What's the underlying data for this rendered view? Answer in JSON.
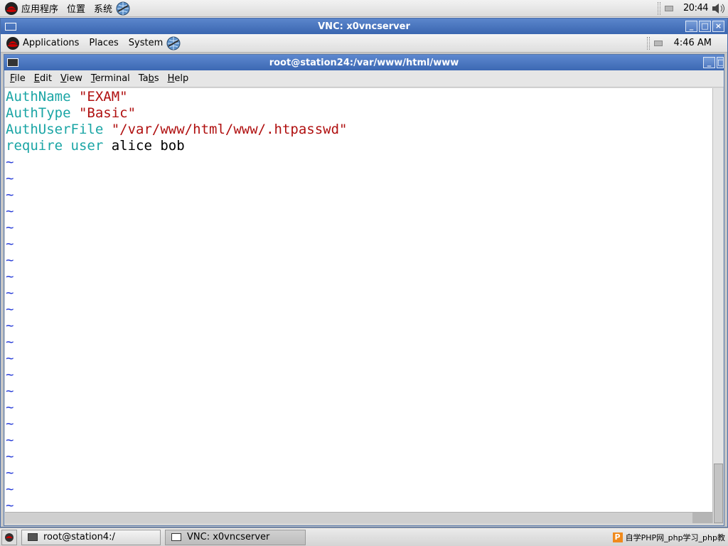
{
  "outer_panel": {
    "menus": [
      "应用程序",
      "位置",
      "系统"
    ],
    "clock": "20:44"
  },
  "vnc_window": {
    "title": "VNC: x0vncserver"
  },
  "inner_panel": {
    "menus": [
      "Applications",
      "Places",
      "System"
    ],
    "clock": "4:46 AM"
  },
  "terminal": {
    "title": "root@station24:/var/www/html/www",
    "menubar": [
      {
        "pre": "",
        "u": "F",
        "post": "ile"
      },
      {
        "pre": "",
        "u": "E",
        "post": "dit"
      },
      {
        "pre": "",
        "u": "V",
        "post": "iew"
      },
      {
        "pre": "",
        "u": "T",
        "post": "erminal"
      },
      {
        "pre": "Ta",
        "u": "b",
        "post": "s"
      },
      {
        "pre": "",
        "u": "H",
        "post": "elp"
      }
    ],
    "lines": [
      {
        "kw": "AuthName",
        "str": "\"EXAM\"",
        "plain": ""
      },
      {
        "kw": "AuthType",
        "str": "\"Basic\"",
        "plain": ""
      },
      {
        "kw": "AuthUserFile",
        "str": "\"/var/www/html/www/.htpasswd\"",
        "plain": ""
      },
      {
        "kw": "require user",
        "str": "",
        "plain": "alice bob"
      }
    ],
    "tilde_char": "~",
    "tilde_count": 22
  },
  "taskbar": {
    "tasks": [
      "root@station4:/",
      "VNC: x0vncserver"
    ],
    "watermark": "自学PHP网_php学习_php教"
  }
}
